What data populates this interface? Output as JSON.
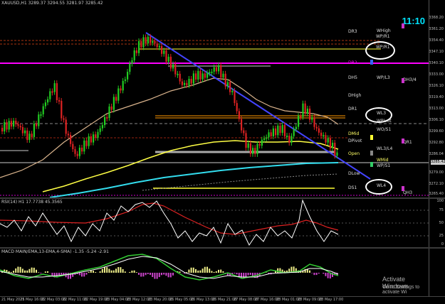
{
  "header": {
    "symbol": "XAUUSD,H1",
    "ohlc": "XAUUSD,H1  3289.37 3294.55 3281.97 3285.42"
  },
  "clock": "11:10",
  "right_axis": {
    "ticks": [
      "3368.20",
      "3361.20",
      "3354.40",
      "3347.10",
      "3340.10",
      "3333.00",
      "3326.10",
      "3319.40",
      "3313.00",
      "3306.10",
      "3299.60",
      "3292.80",
      "3286.04",
      "3279.00",
      "3272.10",
      "3265.40"
    ],
    "current_price": "3285.42"
  },
  "levels": [
    {
      "label": "DR3",
      "color": "#dddddd"
    },
    {
      "label": "WHigh",
      "color": "#dddddd"
    },
    {
      "label": "WP/R1",
      "color": "#dddddd"
    },
    {
      "label": "WP/R1",
      "color": "#dddddd"
    },
    {
      "label": "DR2",
      "color": "#ff00ff"
    },
    {
      "label": "DH5",
      "color": "#dddddd"
    },
    {
      "label": "WP/L3",
      "color": "#dddddd"
    },
    {
      "label": "DH3/4",
      "color": "#dddddd"
    },
    {
      "label": "DHigh",
      "color": "#dddddd"
    },
    {
      "label": "DR1",
      "color": "#dddddd"
    },
    {
      "label": "WL3",
      "color": "#dddddd"
    },
    {
      "label": "WPivot",
      "color": "#dddddd"
    },
    {
      "label": "WO/S1",
      "color": "#dddddd"
    },
    {
      "label": "DMid",
      "color": "#ffff66"
    },
    {
      "label": "DPivot",
      "color": "#dddddd"
    },
    {
      "label": "QR1",
      "color": "#dddddd"
    },
    {
      "label": "WL3/L4",
      "color": "#dddddd"
    },
    {
      "label": "Open",
      "color": "#ffff66"
    },
    {
      "label": "WMid",
      "color": "#ffff66"
    },
    {
      "label": "WP/S1",
      "color": "#dddddd"
    },
    {
      "label": "DLow",
      "color": "#dddddd"
    },
    {
      "label": "DS1",
      "color": "#dddddd"
    },
    {
      "label": "WL4",
      "color": "#dddddd"
    },
    {
      "label": "QH3",
      "color": "#dddddd"
    }
  ],
  "rsi": {
    "title": "RSI(14) H1   17.7738   45.3565",
    "ticks": [
      "100",
      "75",
      "50",
      "25",
      "0"
    ]
  },
  "macd": {
    "title": "MACD MAIN/EMA,13-EMA,4-SMA)  -1.35  -5.24  -2.91"
  },
  "time_axis": [
    "21 May 2025",
    "21 May 16:00",
    "22 May 03:00",
    "22 May 11:00",
    "22 May 19:00",
    "23 May 04:00",
    "23 May 12:00",
    "23 May 20:00",
    "26 May 05:00",
    "26 May 13:00",
    "26 May 21:00",
    "27 May 08:00",
    "27 May 16:00",
    "28 May 01:00",
    "28 May 09:00",
    "28 May 17:00"
  ],
  "watermark": {
    "line1": "Activate Windows",
    "line2": "Go to Settings to activate Wi"
  }
}
